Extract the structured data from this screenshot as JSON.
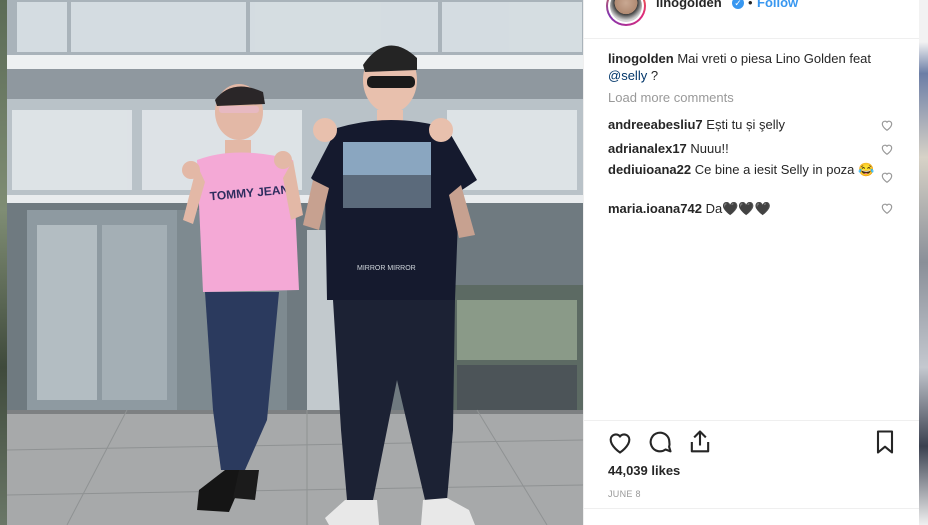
{
  "post": {
    "username": "linogolden",
    "verified_badge": "✓",
    "separator": "•",
    "follow_label": "Follow"
  },
  "caption": {
    "username": "linogolden",
    "text": "Mai vreti o piesa Lino Golden feat",
    "mention": "@selly",
    "tail": " ?"
  },
  "load_more_label": "Load more comments",
  "comments": [
    {
      "user": "andreeabesliu7",
      "text": "Ești tu și şelly"
    },
    {
      "user": "adrianalex17",
      "text": "Nuuu!!"
    },
    {
      "user": "dediuioana22",
      "text": "Ce bine a iesit Selly in poza 😂"
    },
    {
      "user": "maria.ioana742",
      "text": "Da🖤🖤🖤"
    }
  ],
  "likes_text": "44,039 likes",
  "date_text": "JUNE 8",
  "photo": {
    "left_shirt_text": "TOMMY JEANS",
    "right_shirt_text": "MIRROR  MIRROR"
  },
  "icons": {
    "like": "heart-icon",
    "comment": "comment-icon",
    "share": "share-icon",
    "save": "bookmark-icon",
    "comment_like": "small-heart-icon"
  },
  "colors": {
    "link": "#3897f0",
    "muted": "#999999",
    "text": "#262626"
  }
}
